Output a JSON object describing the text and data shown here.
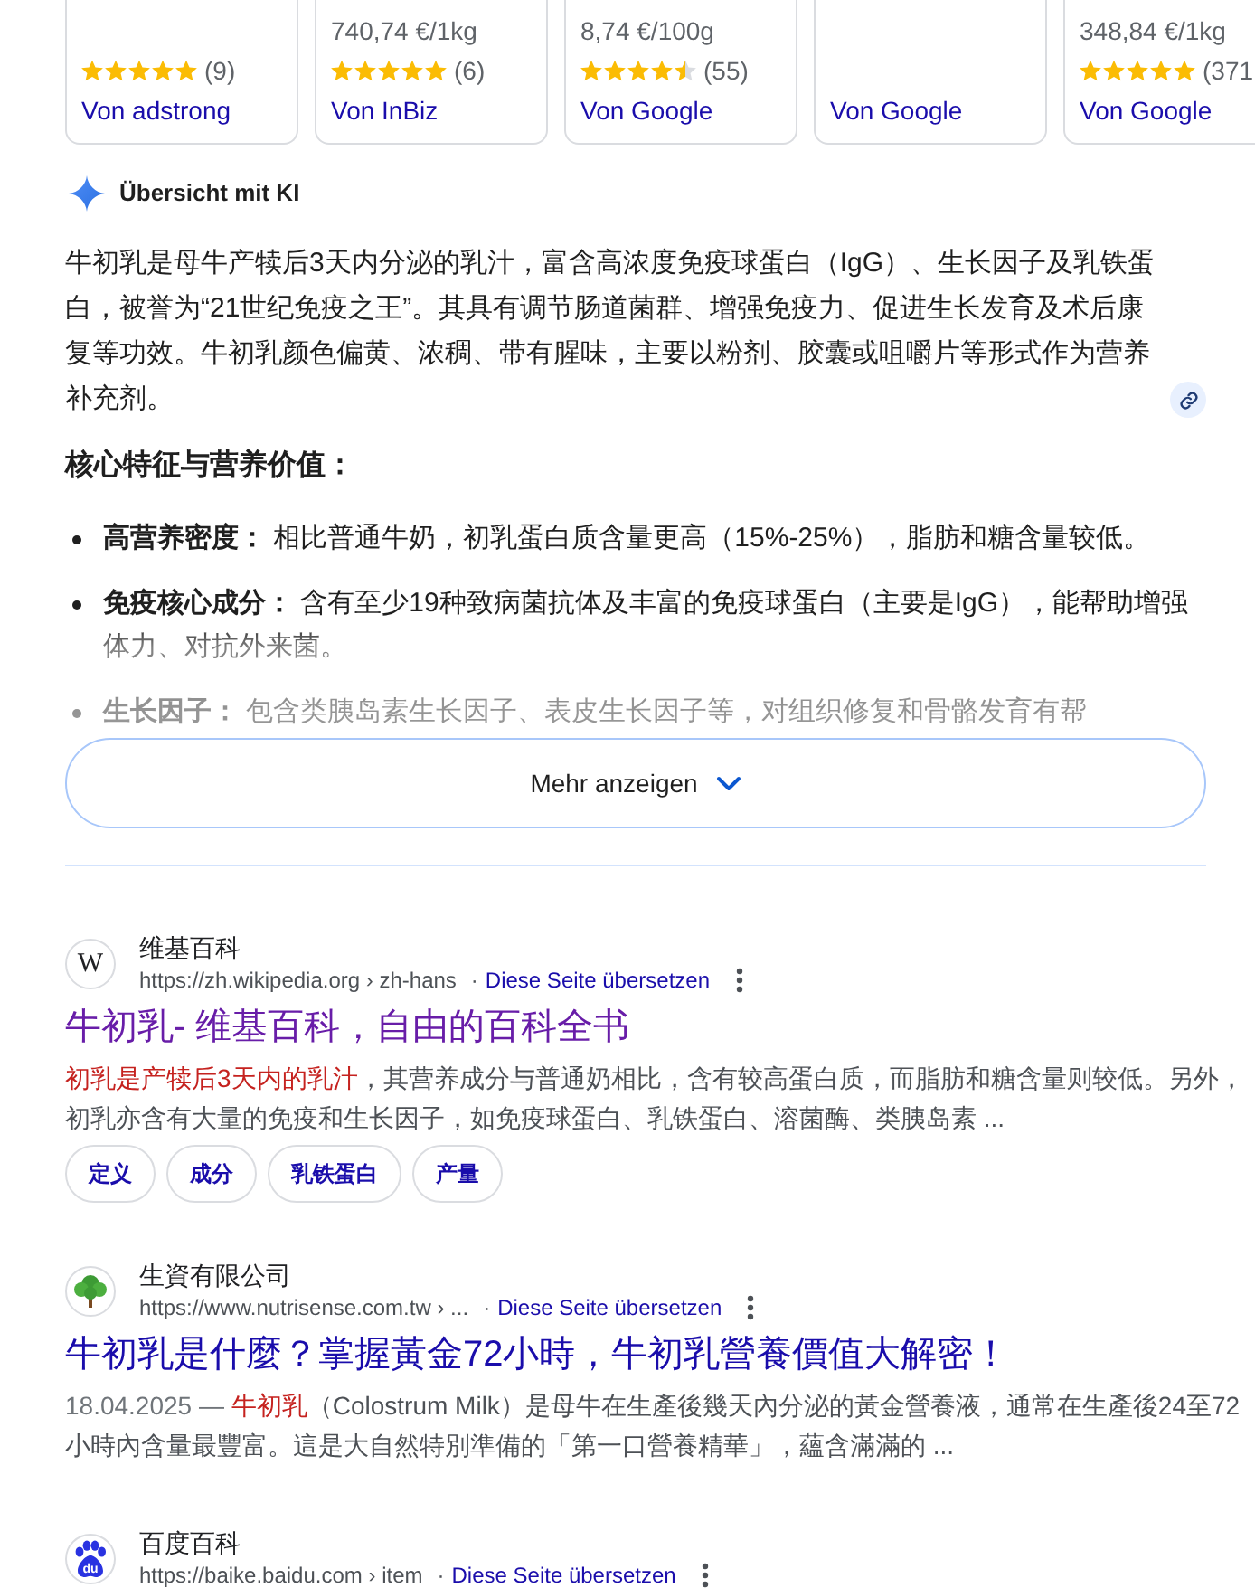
{
  "product_cards": [
    {
      "stars": 5,
      "rating_count": "(9)",
      "vendor": "Von adstrong"
    },
    {
      "price": "740,74 €/1kg",
      "stars": 5,
      "rating_count": "(6)",
      "vendor": "Von InBiz"
    },
    {
      "price": "8,74 €/100g",
      "stars": 4.5,
      "rating_count": "(55)",
      "vendor": "Von Google"
    },
    {
      "vendor": "Von Google"
    },
    {
      "price": "348,84 €/1kg",
      "stars": 5,
      "rating_count": "(371",
      "vendor": "Von Google"
    }
  ],
  "ai_overview": {
    "title": "Übersicht mit KI",
    "paragraph": "牛初乳是母牛产犊后3天内分泌的乳汁，富含高浓度免疫球蛋白（IgG）、生长因子及乳铁蛋白，被誉为“21世纪免疫之王”。其具有调节肠道菌群、增强免疫力、促进生长发育及术后康复等功效。牛初乳颜色偏黄、浓稠、带有腥味，主要以粉剂、胶囊或咀嚼片等形式作为营养补充剂。",
    "heading": "核心特征与营养价值：",
    "points": [
      "**高营养密度：** 相比普通牛奶，初乳蛋白质含量更高（15%-25%），脂肪和糖含量较低。",
      "**免疫核心成分：** 含有至少19种致病菌抗体及丰富的免疫球蛋白（主要是IgG），能帮助增强体力、对抗外来菌。",
      "**生长因子：** 包含类胰岛素生长因子、表皮生长因子等，对组织修复和骨骼发育有帮"
    ],
    "more_button": "Mehr anzeigen"
  },
  "results": [
    {
      "favicon": {
        "kind": "letter",
        "text": "W"
      },
      "site_name": "维基百科",
      "url": "https://zh.wikipedia.org › zh-hans",
      "separator": "·",
      "translate_link": "Diese Seite übersetzen",
      "title": "牛初乳- 维基百科，自由的百科全书",
      "visited": true,
      "snippet": [
        {
          "kind": "highlight",
          "text": "初乳是产犊后3天内的乳汁"
        },
        {
          "kind": "plain",
          "text": "，其营养成分与普通奶相比，含有较高蛋白质，而脂肪和糖含量则较低。另外，初乳亦含有大量的免疫和生长因子，如免疫球蛋白、乳铁蛋白、溶菌酶、类胰岛素 ..."
        }
      ],
      "chips": [
        "定义",
        "成分",
        "乳铁蛋白",
        "产量"
      ]
    },
    {
      "favicon": {
        "kind": "tree"
      },
      "site_name": "生資有限公司",
      "url": "https://www.nutrisense.com.tw › ...",
      "separator": "·",
      "translate_link": "Diese Seite übersetzen",
      "title": "牛初乳是什麼？掌握黃金72小時，牛初乳營養價值大解密！",
      "visited": false,
      "snippet": [
        {
          "kind": "date",
          "text": "18.04.2025 — "
        },
        {
          "kind": "highlight",
          "text": "牛初乳"
        },
        {
          "kind": "plain",
          "text": "（Colostrum Milk）是母牛在生產後幾天內分泌的黃金營養液，通常在生產後24至72小時內含量最豐富。這是大自然特別準備的「第一口營養精華」，蘊含滿滿的 ..."
        }
      ]
    },
    {
      "favicon": {
        "kind": "paw",
        "text": "du"
      },
      "site_name": "百度百科",
      "url": "https://baike.baidu.com › item",
      "separator": "·",
      "translate_link": "Diese Seite übersetzen"
    }
  ]
}
